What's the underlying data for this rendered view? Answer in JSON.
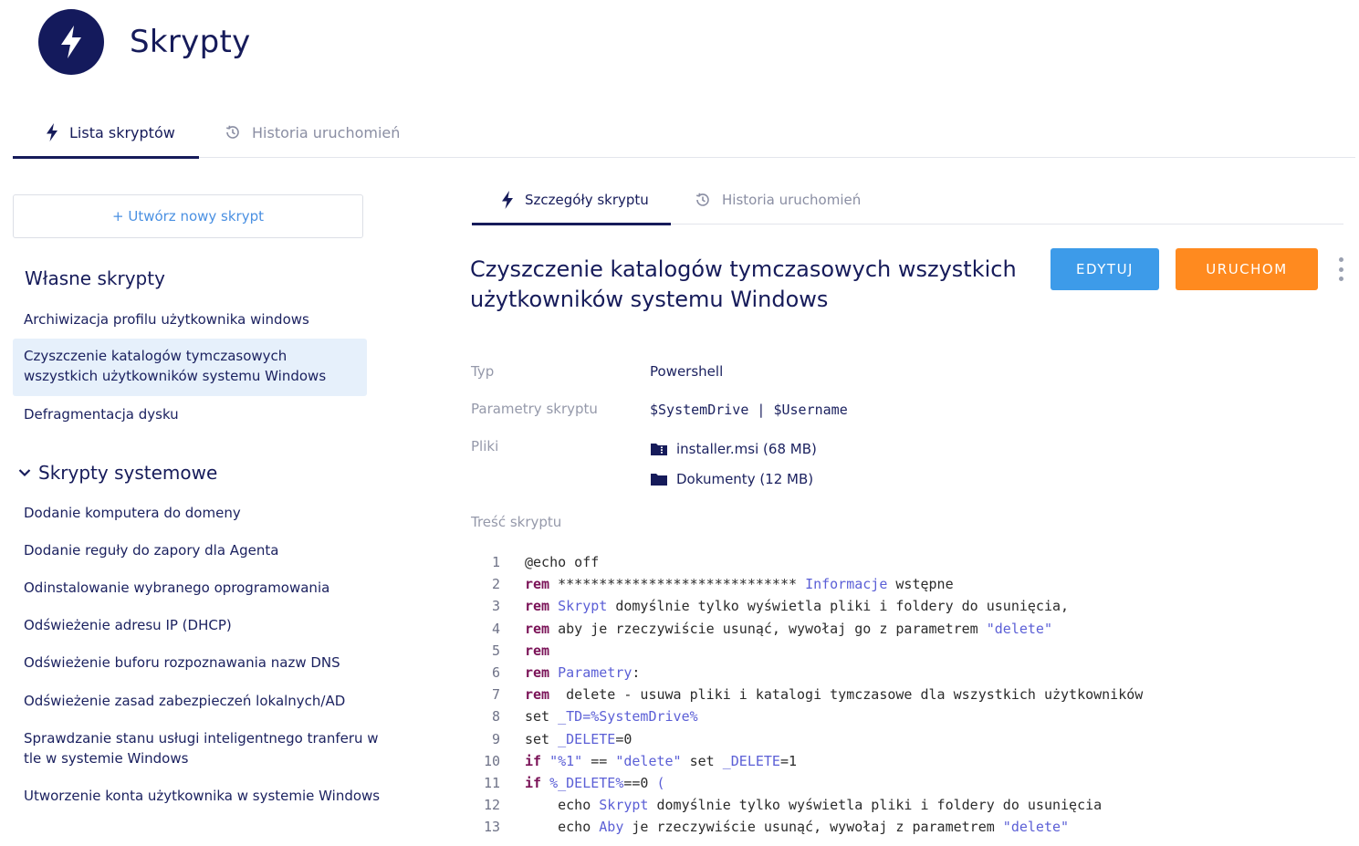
{
  "header": {
    "title": "Skrypty",
    "logo_icon": "lightning-icon"
  },
  "main_tabs": [
    {
      "label": "Lista skryptów",
      "icon": "lightning-icon",
      "active": true
    },
    {
      "label": "Historia uruchomień",
      "icon": "history-icon",
      "active": false
    }
  ],
  "sidebar": {
    "new_button": "+ Utwórz nowy skrypt",
    "own_title": "Własne skrypty",
    "own_items": [
      "Archiwizacja profilu użytkownika windows",
      "Czyszczenie katalogów tymczasowych wszystkich użytkowników systemu Windows",
      "Defragmentacja dysku"
    ],
    "system_title": "Skrypty systemowe",
    "system_items": [
      "Dodanie komputera do domeny",
      "Dodanie reguły do zapory dla Agenta",
      "Odinstalowanie wybranego oprogramowania",
      "Odświeżenie adresu IP (DHCP)",
      "Odświeżenie buforu rozpoznawania nazw DNS",
      "Odświeżenie zasad zabezpieczeń lokalnych/AD",
      "Sprawdzanie stanu usługi inteligentnego tranferu w tle w systemie Windows",
      "Utworzenie konta użytkownika w systemie Windows"
    ]
  },
  "sub_tabs": [
    {
      "label": "Szczegóły skryptu",
      "active": true
    },
    {
      "label": "Historia uruchomień",
      "active": false
    }
  ],
  "details": {
    "title": "Czyszczenie katalogów tymczasowych wszystkich użytkowników systemu Windows",
    "edit_label": "EDYTUJ",
    "run_label": "URUCHOM",
    "type_label": "Typ",
    "type_value": "Powershell",
    "params_label": "Parametry skryptu",
    "params_value": "$SystemDrive | $Username",
    "files_label": "Pliki",
    "files": [
      "installer.msi (68 MB)",
      "Dokumenty (12 MB)"
    ],
    "content_label": "Treść skryptu"
  },
  "code_lines": [
    {
      "n": "1",
      "parts": [
        [
          "p",
          "@echo off"
        ]
      ]
    },
    {
      "n": "2",
      "parts": [
        [
          "k",
          "rem"
        ],
        [
          "p",
          " ***************************** "
        ],
        [
          "t",
          "Informacje"
        ],
        [
          "p",
          " wstępne"
        ]
      ]
    },
    {
      "n": "3",
      "parts": [
        [
          "k",
          "rem"
        ],
        [
          "p",
          " "
        ],
        [
          "t",
          "Skrypt"
        ],
        [
          "p",
          " domyślnie tylko wyświetla pliki i foldery do usunięcia,"
        ]
      ]
    },
    {
      "n": "4",
      "parts": [
        [
          "k",
          "rem"
        ],
        [
          "p",
          " aby je rzeczywiście usunąć, wywołaj go z parametrem "
        ],
        [
          "s",
          "\"delete\""
        ]
      ]
    },
    {
      "n": "5",
      "parts": [
        [
          "k",
          "rem"
        ]
      ]
    },
    {
      "n": "6",
      "parts": [
        [
          "k",
          "rem"
        ],
        [
          "p",
          " "
        ],
        [
          "t",
          "Parametry"
        ],
        [
          "p",
          ":"
        ]
      ]
    },
    {
      "n": "7",
      "parts": [
        [
          "k",
          "rem"
        ],
        [
          "p",
          "  delete - usuwa pliki i katalogi tymczasowe dla wszystkich użytkowników"
        ]
      ]
    },
    {
      "n": "8",
      "parts": [
        [
          "p",
          "set "
        ],
        [
          "t",
          "_TD=%SystemDrive%"
        ]
      ]
    },
    {
      "n": "9",
      "parts": [
        [
          "p",
          "set "
        ],
        [
          "t",
          "_DELETE"
        ],
        [
          "p",
          "=0"
        ]
      ]
    },
    {
      "n": "10",
      "parts": [
        [
          "k",
          "if"
        ],
        [
          "p",
          " "
        ],
        [
          "s",
          "\"%1\""
        ],
        [
          "p",
          " == "
        ],
        [
          "s",
          "\"delete\""
        ],
        [
          "p",
          " set "
        ],
        [
          "t",
          "_DELETE"
        ],
        [
          "p",
          "=1"
        ]
      ]
    },
    {
      "n": "11",
      "parts": [
        [
          "k",
          "if"
        ],
        [
          "p",
          " "
        ],
        [
          "t",
          "%_DELETE%"
        ],
        [
          "p",
          "==0 "
        ],
        [
          "t",
          "("
        ]
      ]
    },
    {
      "n": "12",
      "parts": [
        [
          "p",
          "    echo "
        ],
        [
          "t",
          "Skrypt"
        ],
        [
          "p",
          " domyślnie tylko wyświetla pliki i foldery do usunięcia"
        ]
      ]
    },
    {
      "n": "13",
      "parts": [
        [
          "p",
          "    echo "
        ],
        [
          "t",
          "Aby"
        ],
        [
          "p",
          " je rzeczywiście usunąć, wywołaj z parametrem "
        ],
        [
          "s",
          "\"delete\""
        ]
      ]
    }
  ],
  "colors": {
    "navy": "#161b5a",
    "edit_button": "#3d9be9",
    "run_button": "#ff8a1f",
    "selected_bg": "#e6f0fb",
    "link_blue": "#4a90e2"
  }
}
